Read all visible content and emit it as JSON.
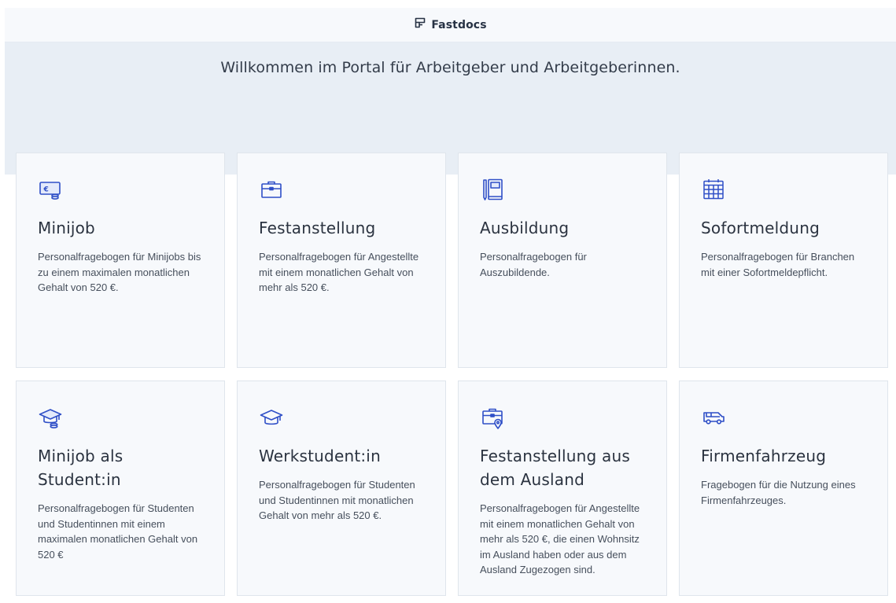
{
  "brand": {
    "name": "Fastdocs",
    "icon": "fastdocs-logo-icon"
  },
  "hero": {
    "welcome": "Willkommen im Portal für Arbeitgeber und Arbeitgeberinnen."
  },
  "colors": {
    "accent": "#2f4fc7",
    "hero_bg": "#e8eef5",
    "card_bg": "#f7f9fc"
  },
  "cards": [
    {
      "icon": "money-icon",
      "title": "Minijob",
      "description": "Personalfragebogen für Minijobs bis zu einem maximalen monatlichen Gehalt von 520 €."
    },
    {
      "icon": "briefcase-icon",
      "title": "Festanstellung",
      "description": "Personalfragebogen für Angestellte mit einem monatlichen Gehalt von mehr als 520 €."
    },
    {
      "icon": "notebook-icon",
      "title": "Ausbildung",
      "description": "Personalfragebogen für Auszubildende."
    },
    {
      "icon": "calendar-icon",
      "title": "Sofortmeldung",
      "description": "Personalfragebogen für Branchen mit einer Sofortmeldepflicht."
    },
    {
      "icon": "graduation-cap-coins-icon",
      "title": "Minijob als Student:in",
      "description": "Personalfragebogen für Studenten und Studentinnen mit einem maximalen monatlichen Gehalt von 520 €"
    },
    {
      "icon": "graduation-cap-icon",
      "title": "Werkstudent:in",
      "description": "Personalfragebogen für Studenten und Studentinnen mit monatlichen Gehalt von mehr als 520 €."
    },
    {
      "icon": "briefcase-location-icon",
      "title": "Festanstellung aus dem Ausland",
      "description": "Personalfragebogen für Angestellte mit einem monatlichen Gehalt von mehr als 520 €, die einen Wohnsitz im Ausland haben oder aus dem Ausland Zugezogen sind."
    },
    {
      "icon": "vehicle-icon",
      "title": "Firmenfahrzeug",
      "description": "Fragebogen für die Nutzung eines Firmenfahrzeuges."
    }
  ]
}
